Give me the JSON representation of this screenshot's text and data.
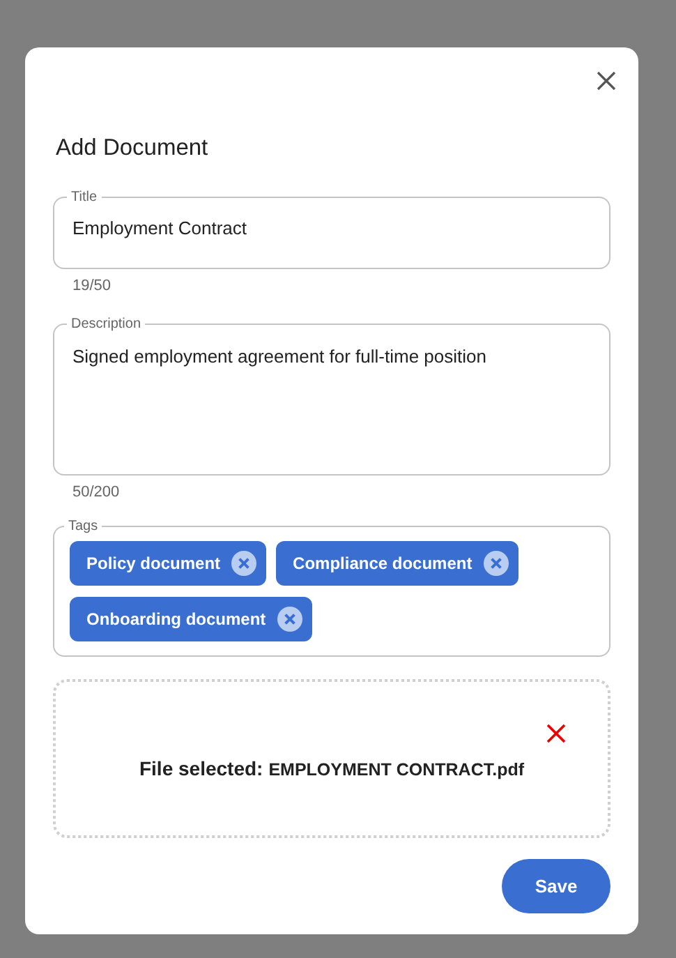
{
  "dialog": {
    "title": "Add Document"
  },
  "title_field": {
    "label": "Title",
    "value": "Employment Contract",
    "counter": "19/50"
  },
  "description_field": {
    "label": "Description",
    "value": "Signed employment agreement for full-time position",
    "counter": "50/200"
  },
  "tags": {
    "label": "Tags",
    "items": [
      {
        "label": "Policy document"
      },
      {
        "label": "Compliance document"
      },
      {
        "label": "Onboarding document"
      }
    ]
  },
  "file": {
    "label": "File selected:",
    "name": "EMPLOYMENT CONTRACT.pdf"
  },
  "buttons": [
    "Save"
  ]
}
